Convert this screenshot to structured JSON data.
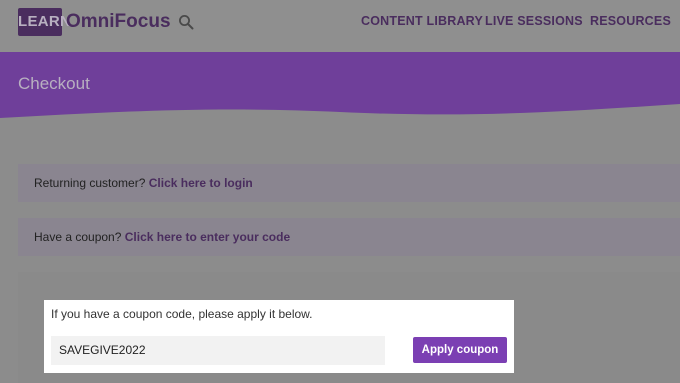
{
  "header": {
    "logo_badge": "LEARN",
    "logo_text": "OmniFocus",
    "search_icon": "search-icon",
    "nav": {
      "content_library": "CONTENT LIBRARY",
      "live_sessions": "LIVE SESSIONS",
      "resources": "RESOURCES"
    }
  },
  "banner": {
    "title": "Checkout"
  },
  "notices": {
    "returning_prefix": "Returning customer?",
    "returning_link": "Click here to login",
    "coupon_prefix": "Have a coupon?",
    "coupon_link": "Click here to enter your code"
  },
  "coupon_form": {
    "instruction": "If you have a coupon code, please apply it below.",
    "input_value": "SAVEGIVE2022",
    "apply_label": "Apply coupon"
  },
  "colors": {
    "brand_purple": "#4a2d5e",
    "banner_purple": "#6f3f9a",
    "button_purple": "#7b3fb3"
  }
}
